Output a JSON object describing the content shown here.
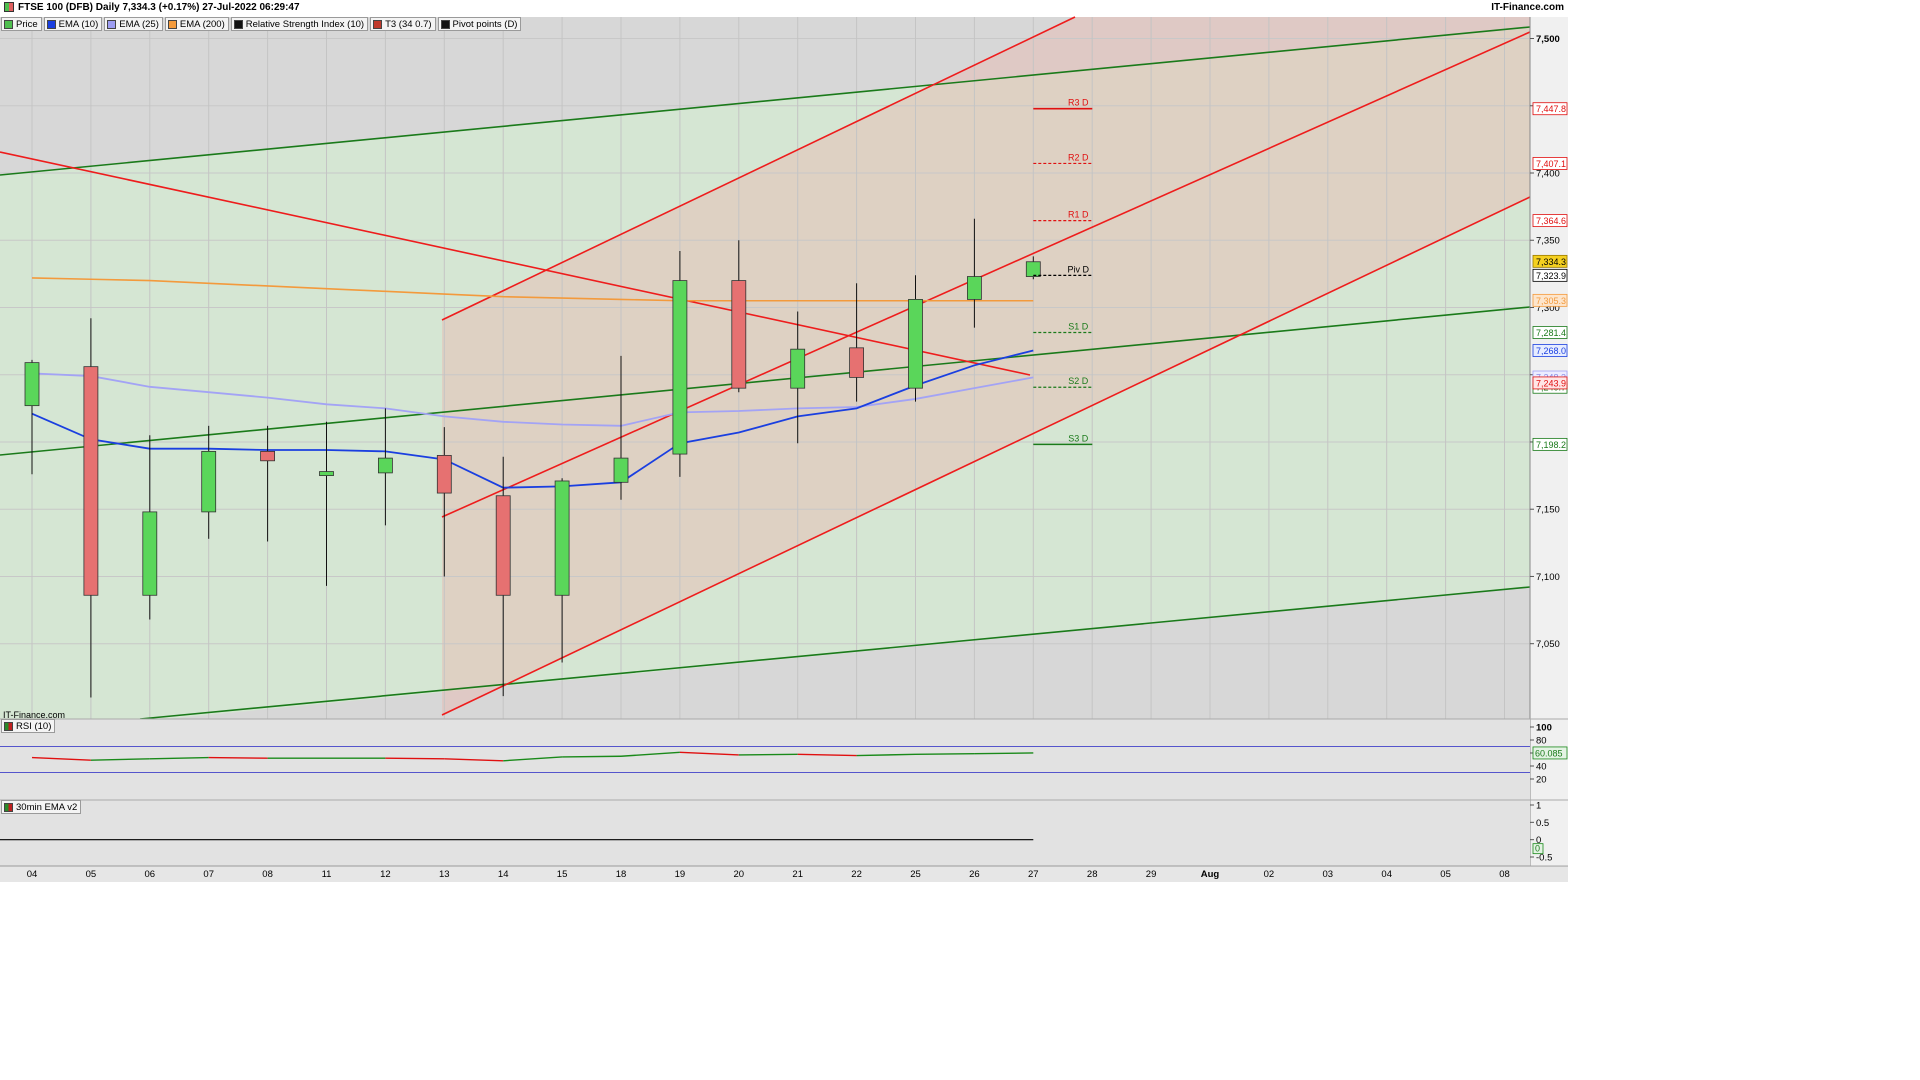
{
  "header": {
    "title": "FTSE 100 (DFB) Daily 7,334.3 (+0.17%) 27-Jul-2022 06:29:47",
    "brand": "IT-Finance.com"
  },
  "watermark": "IT-Finance.com",
  "legend": [
    {
      "label": "Price",
      "color": "#4fbf4f"
    },
    {
      "label": "EMA (10)",
      "color": "#1a3fe0"
    },
    {
      "label": "EMA (25)",
      "color": "#9d9df2"
    },
    {
      "label": "EMA (200)",
      "color": "#f39a3c"
    },
    {
      "label": "Relative Strength Index (10)",
      "color": "#111111"
    },
    {
      "label": "T3 (34 0.7)",
      "color": "#c0392b"
    },
    {
      "label": "Pivot points (D)",
      "color": "#111111"
    }
  ],
  "colors": {
    "up": "#5ad65a",
    "down": "#e67171",
    "ema10": "#1a3fe0",
    "ema25": "#a3a3f5",
    "ema200": "#f39a3c",
    "trend_red": "#ee1c1c",
    "trend_green": "#1a7a1a"
  },
  "chart_data": {
    "type": "candlestick",
    "x_labels": [
      "04",
      "05",
      "06",
      "07",
      "08",
      "11",
      "12",
      "13",
      "14",
      "15",
      "18",
      "19",
      "20",
      "21",
      "22",
      "25",
      "26",
      "27",
      "28",
      "29",
      "Aug",
      "02",
      "03",
      "04",
      "05",
      "08"
    ],
    "y_ticks": [
      7050,
      7100,
      7150,
      7200,
      7250,
      7300,
      7350,
      7400,
      7450,
      7500
    ],
    "y_tick_labels": [
      "7,050",
      "7,100",
      "7,150",
      "7,200",
      "7,250",
      "7,300",
      "7,350",
      "7,400",
      "7,450",
      "7,500"
    ],
    "ylim": [
      6994,
      7516
    ],
    "candles": [
      {
        "date": "04",
        "open": 7227,
        "high": 7261,
        "low": 7176,
        "close": 7259
      },
      {
        "date": "05",
        "open": 7256,
        "high": 7292,
        "low": 7010,
        "close": 7086
      },
      {
        "date": "06",
        "open": 7086,
        "high": 7205,
        "low": 7068,
        "close": 7148
      },
      {
        "date": "07",
        "open": 7148,
        "high": 7212,
        "low": 7128,
        "close": 7193
      },
      {
        "date": "08",
        "open": 7193,
        "high": 7212,
        "low": 7126,
        "close": 7186
      },
      {
        "date": "11",
        "open": 7175,
        "high": 7215,
        "low": 7093,
        "close": 7178
      },
      {
        "date": "12",
        "open": 7177,
        "high": 7225,
        "low": 7138,
        "close": 7188
      },
      {
        "date": "13",
        "open": 7190,
        "high": 7211,
        "low": 7100,
        "close": 7162
      },
      {
        "date": "14",
        "open": 7160,
        "high": 7189,
        "low": 7011,
        "close": 7086
      },
      {
        "date": "15",
        "open": 7086,
        "high": 7173,
        "low": 7036,
        "close": 7171
      },
      {
        "date": "18",
        "open": 7170,
        "high": 7264,
        "low": 7157,
        "close": 7188
      },
      {
        "date": "19",
        "open": 7191,
        "high": 7342,
        "low": 7174,
        "close": 7320
      },
      {
        "date": "20",
        "open": 7320,
        "high": 7350,
        "low": 7237,
        "close": 7240
      },
      {
        "date": "21",
        "open": 7240,
        "high": 7297,
        "low": 7199,
        "close": 7269
      },
      {
        "date": "22",
        "open": 7270,
        "high": 7318,
        "low": 7230,
        "close": 7248
      },
      {
        "date": "25",
        "open": 7240,
        "high": 7324,
        "low": 7230,
        "close": 7306
      },
      {
        "date": "26",
        "open": 7306,
        "high": 7366,
        "low": 7285,
        "close": 7323
      },
      {
        "date": "27",
        "open": 7323,
        "high": 7338,
        "low": 7321,
        "close": 7334
      }
    ],
    "ema10": [
      7221,
      7202,
      7195,
      7195,
      7194,
      7194,
      7193,
      7187,
      7166,
      7167,
      7170,
      7199,
      7207,
      7219,
      7225,
      7242,
      7257,
      7268
    ],
    "ema25": [
      7251,
      7249,
      7241,
      7237,
      7233,
      7228,
      7225,
      7219,
      7215,
      7213,
      7212,
      7222,
      7223,
      7225,
      7226,
      7232,
      7240,
      7248
    ],
    "ema200": [
      7322,
      7321,
      7320,
      7318,
      7316,
      7314,
      7312,
      7310,
      7308,
      7307,
      7306,
      7305,
      7305,
      7305,
      7305,
      7305,
      7305,
      7305
    ],
    "pivots": [
      {
        "label": "R3 D",
        "value": 7447.8,
        "value_label": "7,447.8",
        "style": "solid",
        "color": "#e01010"
      },
      {
        "label": "R2 D",
        "value": 7407.1,
        "value_label": "7,407.1",
        "style": "dashed",
        "color": "#e01010"
      },
      {
        "label": "R1 D",
        "value": 7364.6,
        "value_label": "7,364.6",
        "style": "dashed",
        "color": "#e01010"
      },
      {
        "label": "Piv D",
        "value": 7323.9,
        "value_label": "7,323.9",
        "style": "dashed",
        "color": "#000000"
      },
      {
        "label": "S1 D",
        "value": 7281.4,
        "value_label": "7,281.4",
        "style": "dashed",
        "color": "#1a7a1a"
      },
      {
        "label": "S2 D",
        "value": 7240.7,
        "value_label": "7,240.7",
        "style": "dashed",
        "color": "#1a7a1a"
      },
      {
        "label": "S3 D",
        "value": 7198.2,
        "value_label": "7,198.2",
        "style": "solid",
        "color": "#1a7a1a"
      }
    ],
    "price_tags": [
      {
        "value": 7334.3,
        "label": "7,334.3",
        "bg": "#f5d020",
        "color": "#000000",
        "border": "#9a7a00"
      },
      {
        "value": 7305.3,
        "label": "7,305.3",
        "bg": "#fde5cc",
        "color": "#f39a3c",
        "border": "#f39a3c"
      },
      {
        "value": 7268.0,
        "label": "7,268.0",
        "bg": "#e6ecff",
        "color": "#1a3fe0",
        "border": "#1a3fe0"
      },
      {
        "value": 7248.3,
        "label": "7,248.3",
        "bg": "#ececff",
        "color": "#8c8ce6",
        "border": "#a3a3f5"
      },
      {
        "value": 7243.9,
        "label": "7,243.9",
        "bg": "#ffe6e6",
        "color": "#e01010",
        "border": "#e01010"
      }
    ]
  },
  "rsi": {
    "label": "RSI (10)",
    "ticks": [
      "100",
      "80",
      "60",
      "40",
      "20"
    ],
    "tick_values": [
      100,
      80,
      60,
      40,
      20
    ],
    "values": [
      53,
      49,
      51,
      53,
      52,
      52,
      52,
      51,
      48,
      54,
      55,
      61,
      57,
      58,
      56,
      58,
      59,
      60.085
    ],
    "last_label": "60.085",
    "bands": [
      70,
      30
    ]
  },
  "ema30": {
    "label": "30min EMA v2",
    "ticks": [
      "1",
      "0.5",
      "0",
      "-0.5"
    ],
    "tick_values": [
      1,
      0.5,
      0,
      -0.5
    ],
    "last_label": "0"
  }
}
